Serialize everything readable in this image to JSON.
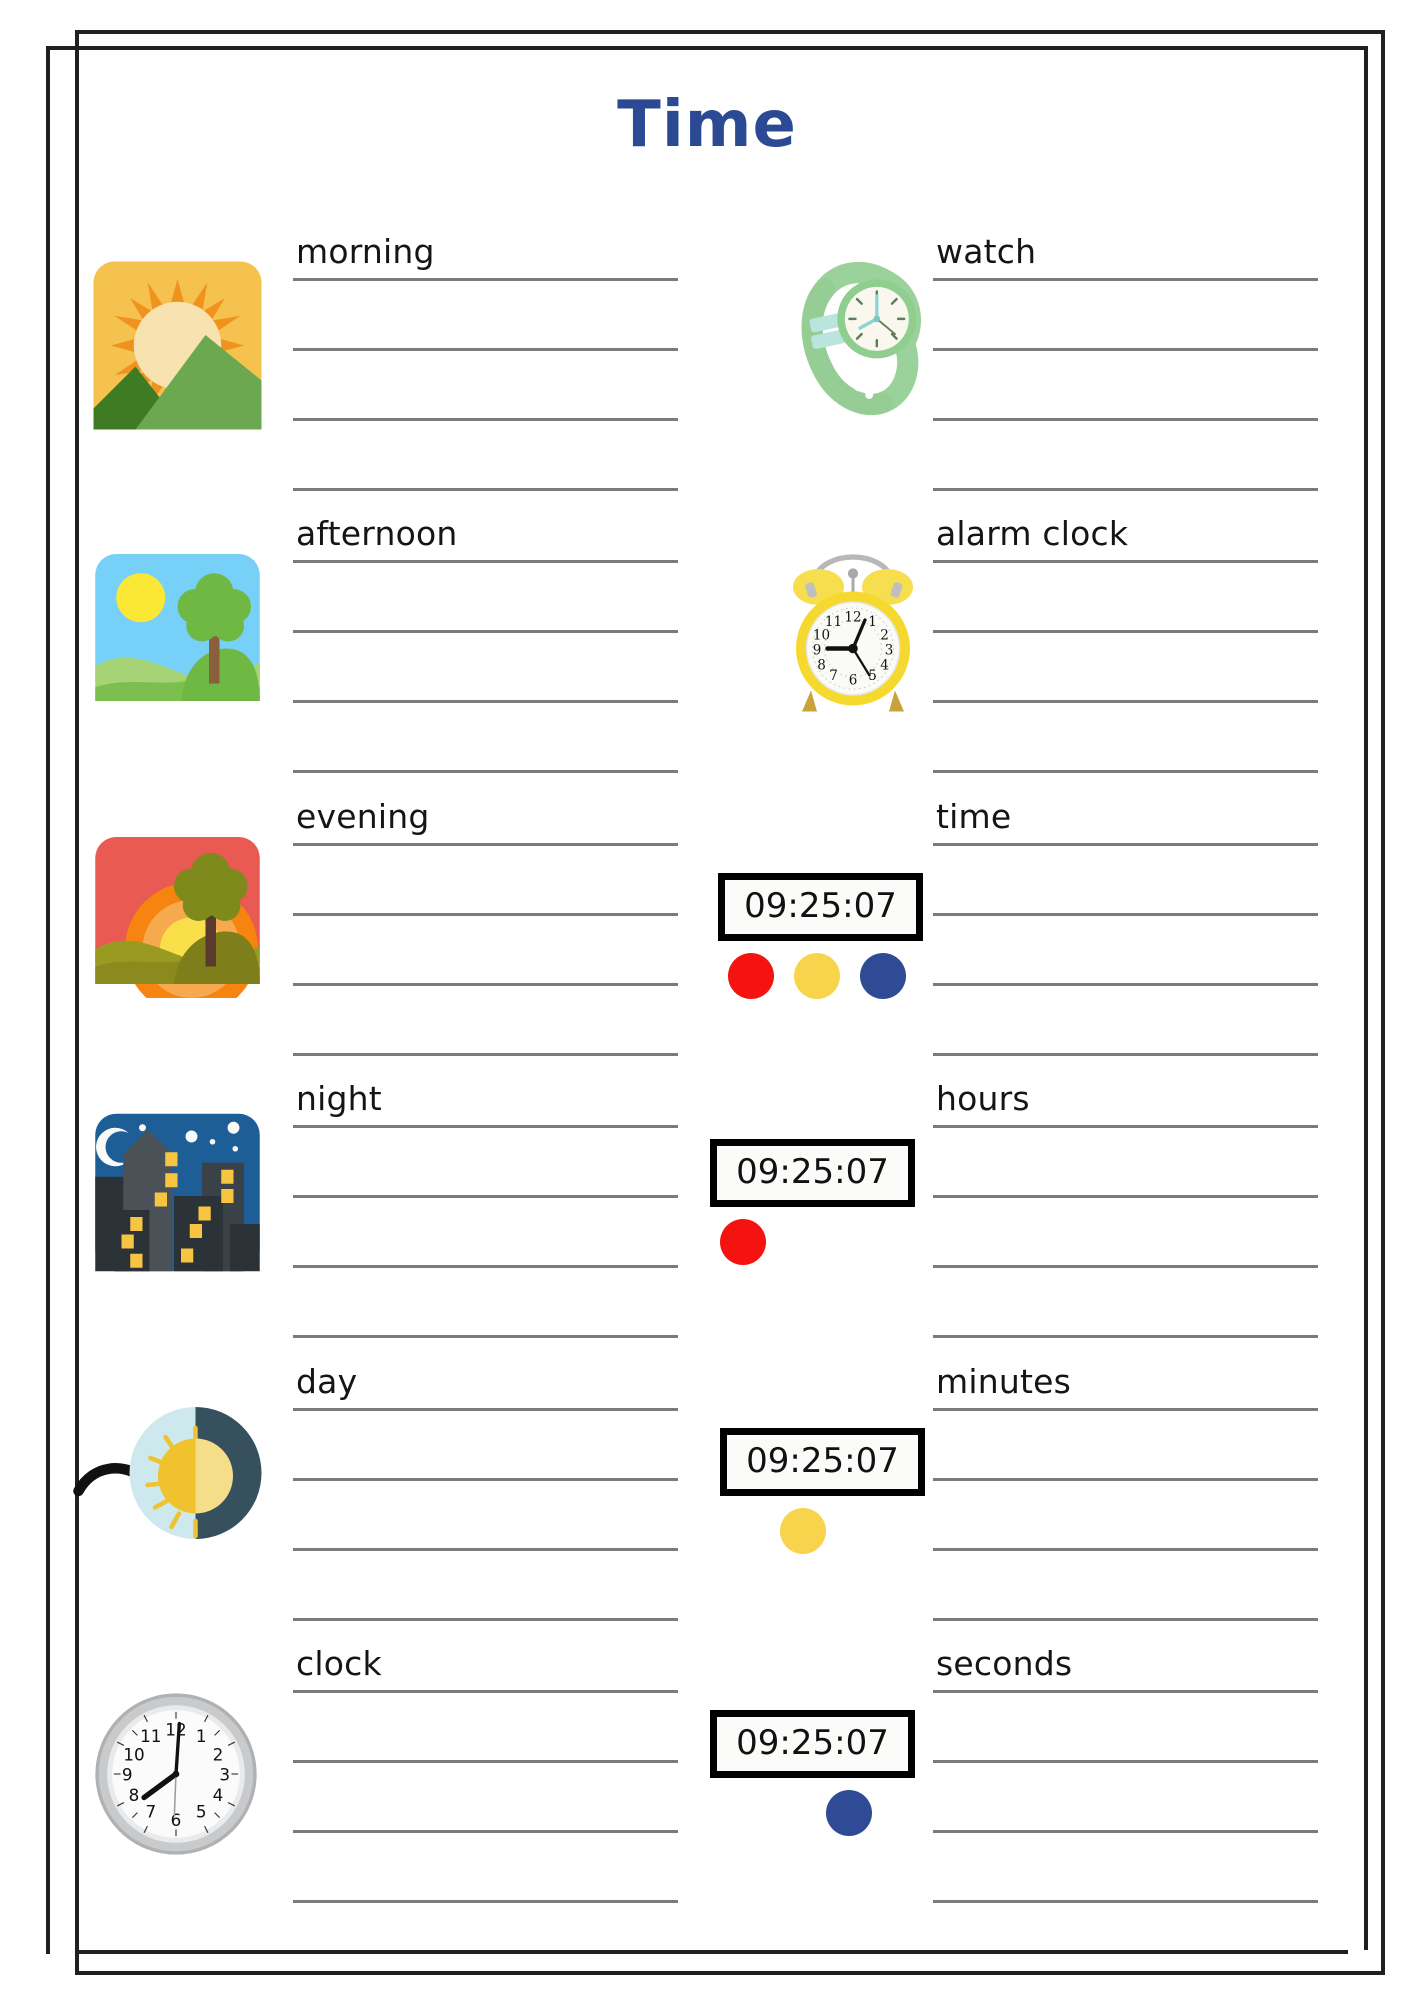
{
  "page": {
    "title": "Time",
    "title_color": "#2b4a93",
    "line_color": "#7b7b7b",
    "frame_color": "#231f20",
    "background": "#ffffff"
  },
  "clock_colors": {
    "red": "#F41310",
    "yellow": "#F8D44C",
    "blue": "#2F4B96"
  },
  "rows": [
    {
      "id": "morning",
      "word": "morning",
      "art": "sunrise-mountains-icon",
      "lines": 4
    },
    {
      "id": "watch",
      "word": "watch",
      "art": "wristwatch-illustration",
      "lines": 4
    },
    {
      "id": "afternoon",
      "word": "afternoon",
      "art": "daytime-tree-landscape-icon",
      "lines": 4
    },
    {
      "id": "alarm-clock",
      "word": "alarm clock",
      "art": "yellow-alarm-clock-illustration",
      "lines": 4
    },
    {
      "id": "evening",
      "word": "evening",
      "art": "sunset-tree-landscape-icon",
      "lines": 4
    },
    {
      "id": "time",
      "word": "time",
      "art": "digital-clock-widget",
      "digital_value": "09:25:07",
      "dots": [
        "red",
        "yellow",
        "blue"
      ],
      "lines": 4
    },
    {
      "id": "night",
      "word": "night",
      "art": "night-cityscape-icon",
      "lines": 4
    },
    {
      "id": "hours",
      "word": "hours",
      "art": "digital-clock-widget",
      "digital_value": "09:25:07",
      "dots": [
        "red"
      ],
      "lines": 4
    },
    {
      "id": "day",
      "word": "day",
      "art": "day-night-cycle-icon",
      "lines": 4
    },
    {
      "id": "minutes",
      "word": "minutes",
      "art": "digital-clock-widget",
      "digital_value": "09:25:07",
      "dots": [
        "yellow"
      ],
      "lines": 4
    },
    {
      "id": "clock",
      "word": "clock",
      "art": "wall-clock-illustration",
      "lines": 4
    },
    {
      "id": "seconds",
      "word": "seconds",
      "art": "digital-clock-widget",
      "digital_value": "09:25:07",
      "dots": [
        "blue"
      ],
      "lines": 4
    }
  ]
}
